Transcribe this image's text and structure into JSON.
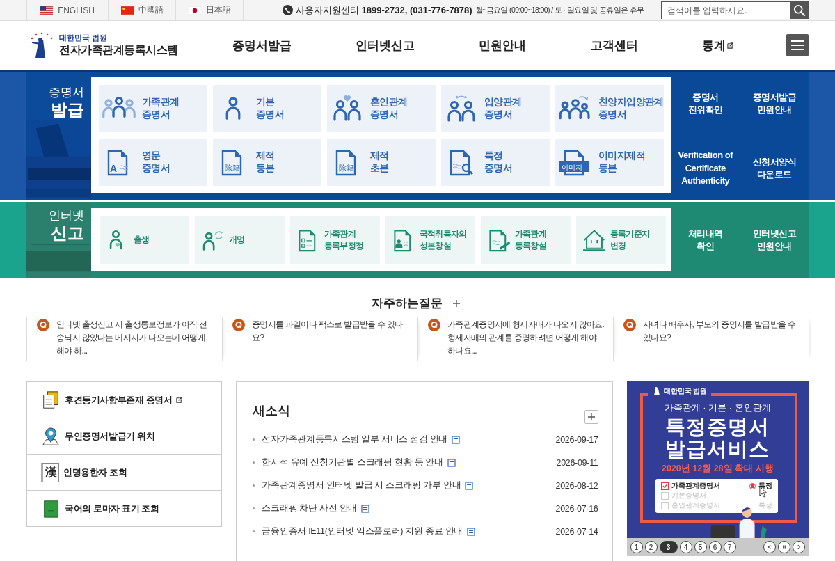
{
  "top_bar": {
    "languages": [
      {
        "label": "ENGLISH"
      },
      {
        "label": "中國語"
      },
      {
        "label": "日本語"
      }
    ],
    "support": "사용자지원센터 **1899-2732, (031-776-7878)**",
    "hours": "월~금요일 (09:00~18:00) / 토 · 일요일 및 공휴일은 휴무",
    "search": {
      "placeholder": "검색어를 입력하세요."
    }
  },
  "header": {
    "org": "대한민국 법원",
    "title": "전자가족관계등록시스템",
    "nav": [
      {
        "label": "증명서발급",
        "external": false
      },
      {
        "label": "인터넷신고",
        "external": false
      },
      {
        "label": "민원안내",
        "external": false
      },
      {
        "label": "고객센터",
        "external": false
      },
      {
        "label": "통계",
        "external": true
      }
    ]
  },
  "sections": [
    {
      "kind": "issue",
      "title_top": "증명서",
      "title_bottom": "발급",
      "tiles": [
        {
          "lines": [
            "가족관계",
            "증명서"
          ]
        },
        {
          "lines": [
            "기본",
            "증명서"
          ]
        },
        {
          "lines": [
            "혼인관계",
            "증명서"
          ]
        },
        {
          "lines": [
            "입양관계",
            "증명서"
          ]
        },
        {
          "lines": [
            "친양자입양관계",
            "증명서"
          ]
        },
        {
          "icon_text": "A",
          "lines": [
            "영문",
            "증명서"
          ]
        },
        {
          "icon_text": "除籍",
          "lines": [
            "제적",
            "등본"
          ]
        },
        {
          "icon_text": "除籍",
          "lines": [
            "제적",
            "초본"
          ]
        },
        {
          "lines": [
            "특정",
            "증명서"
          ]
        },
        {
          "icon_text": "이미지",
          "lines": [
            "이미지제적",
            "등본"
          ]
        }
      ],
      "links": [
        {
          "lines": [
            "증명서",
            "진위확인"
          ]
        },
        {
          "lines": [
            "증명서발급",
            "민원안내"
          ]
        },
        {
          "lines": [
            "Verification of",
            "Certificate",
            "Authenticity"
          ]
        },
        {
          "lines": [
            "신청서양식",
            "다운로드"
          ]
        }
      ]
    },
    {
      "kind": "report",
      "title_top": "인터넷",
      "title_bottom": "신고",
      "tiles": [
        {
          "lines": [
            "출생"
          ]
        },
        {
          "lines": [
            "개명"
          ]
        },
        {
          "lines": [
            "가족관계",
            "등록부정정"
          ]
        },
        {
          "lines": [
            "국적취득자의",
            "성본창설"
          ]
        },
        {
          "lines": [
            "가족관계",
            "등록창설"
          ]
        },
        {
          "lines": [
            "등록기준지",
            "변경"
          ]
        }
      ],
      "links": [
        {
          "lines": [
            "처리내역",
            "확인"
          ]
        },
        {
          "lines": [
            "인터넷신고",
            "민원안내"
          ]
        }
      ]
    }
  ],
  "faq": {
    "title": "자주하는질문",
    "items": [
      "인터넷 출생신고 시 출생통보정보가 아직 전송되지 않았다는 메시지가 나오는데 어떻게 해야 하...",
      "증명서를 파일이나 팩스로 발급받을 수 있나요?",
      "가족관계증명서에 형제자매가 나오지 않아요. 형제자매의 관계를 증명하려면 어떻게 해야 하나요...",
      "자녀나 배우자, 부모의 증명서를 발급받을 수 있나요?"
    ]
  },
  "quick_links": [
    {
      "label": "후견등기사항부존재 증명서",
      "external": true
    },
    {
      "label": "무인증명서발급기 위치",
      "external": false
    },
    {
      "icon_text": "漢",
      "label": "인명용한자 조회",
      "external": false
    },
    {
      "label": "국어의 로마자 표기 조회",
      "external": false
    }
  ],
  "news": {
    "title": "새소식",
    "items": [
      {
        "title": "전자가족관계등록시스템 일부 서비스 점검 안내",
        "date": "2026-09-17"
      },
      {
        "title": "한시적 유예 신청기관별 스크래핑 현황 등 안내",
        "date": "2026-09-11"
      },
      {
        "title": "가족관계증명서 인터넷 발급 시 스크래핑 가부 안내",
        "date": "2026-08-12"
      },
      {
        "title": "스크래핑 차단 사전 안내",
        "date": "2026-07-16"
      },
      {
        "title": "금융인증서 IE11(인터넷 익스플로러) 지원 종료 안내",
        "date": "2026-07-14"
      }
    ]
  },
  "banner": {
    "org": "대한민국 법원",
    "subtitle": "가족관계 · 기본 · 혼인관계",
    "headline": [
      "특정증명서",
      "발급서비스"
    ],
    "notice": "2020년 12월 28일 확대 시행",
    "options": [
      {
        "label": "가족관계증명서",
        "checked": true,
        "option": "특정",
        "option_selected": true
      },
      {
        "label": "기본증명서",
        "checked": false
      },
      {
        "label": "혼인관계증명서",
        "checked": false,
        "option": "특정"
      }
    ],
    "pages": [
      {
        "label": "1",
        "selected": false
      },
      {
        "label": "2",
        "selected": false
      },
      {
        "label": "3",
        "selected": true
      },
      {
        "label": "4",
        "selected": false
      },
      {
        "label": "5",
        "selected": false
      },
      {
        "label": "6",
        "selected": false
      },
      {
        "label": "7",
        "selected": false
      }
    ]
  }
}
